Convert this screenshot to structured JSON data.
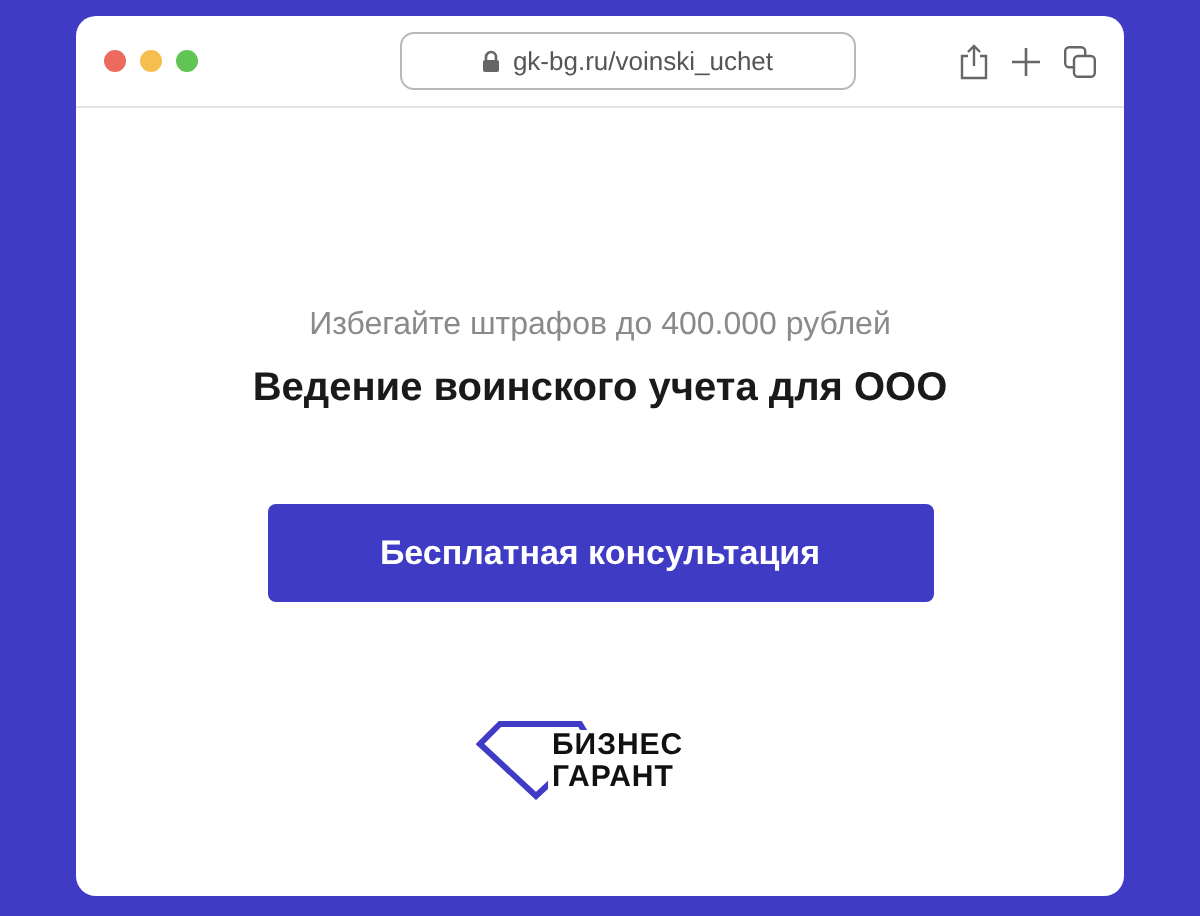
{
  "browser": {
    "url": "gk-bg.ru/voinski_uchet"
  },
  "hero": {
    "subtitle": "Избегайте штрафов до 400.000 рублей",
    "title": "Ведение воинского учета для ООО",
    "button": "Бесплатная консультация"
  },
  "logo": {
    "lines": [
      "БИЗНЕС",
      "ГАРАНТ"
    ]
  }
}
